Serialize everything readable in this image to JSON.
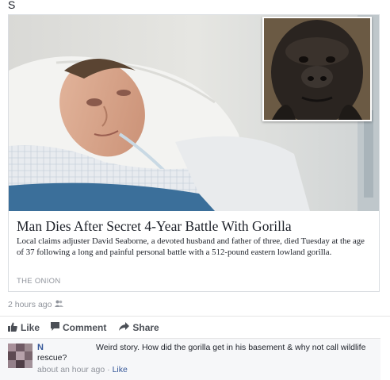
{
  "header": {
    "letter": "S"
  },
  "article": {
    "headline": "Man Dies After Secret 4-Year Battle With Gorilla",
    "description": "Local claims adjuster David Seaborne, a devoted husband and father of three, died Tuesday at the age of 37 following a long and painful personal battle with a 512-pound eastern lowland gorilla.",
    "source": "THE ONION"
  },
  "post": {
    "timestamp": "2 hours ago",
    "privacy_icon": "friends-icon"
  },
  "actions": {
    "like": "Like",
    "comment": "Comment",
    "share": "Share"
  },
  "comment": {
    "author": "N",
    "text": "Weird story. How did the gorilla get in his basement & why not call wildlife rescue?",
    "time": "about an hour ago",
    "separator": "·",
    "like": "Like"
  },
  "colors": {
    "link": "#365899",
    "meta": "#90949c",
    "action": "#4b4f56"
  }
}
